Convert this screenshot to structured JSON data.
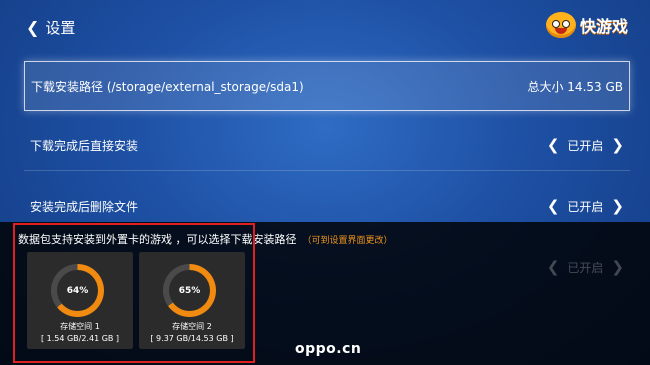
{
  "header": {
    "back_icon": "chevron-left-icon",
    "title": "设置",
    "logo_text": "快游戏"
  },
  "settings": {
    "path_row": {
      "label": "下载安装路径 (/storage/external_storage/sda1)",
      "total_size": "总大小 14.53 GB"
    },
    "rows": [
      {
        "label": "下载完成后直接安装",
        "value": "已开启"
      },
      {
        "label": "安装完成后删除文件",
        "value": "已开启"
      },
      {
        "label": "",
        "value": "已开启"
      }
    ]
  },
  "storage_popup": {
    "title": "数据包支持安装到外置卡的游戏 ，可以选择下载安装路径",
    "hint": "（可到设置界面更改）",
    "cards": [
      {
        "percent_label": "64%",
        "percent": 64,
        "name": "存储空间 1",
        "size": "[ 1.54 GB/2.41 GB ]"
      },
      {
        "percent_label": "65%",
        "percent": 65,
        "name": "存储空间 2",
        "size": "[ 9.37 GB/14.53 GB ]"
      }
    ]
  },
  "colors": {
    "accent_orange": "#f0961c",
    "ring_track": "#4a4a4a",
    "ring_fill": "#f08a10",
    "highlight_box": "#e02020"
  },
  "watermark": "oppo.cn"
}
